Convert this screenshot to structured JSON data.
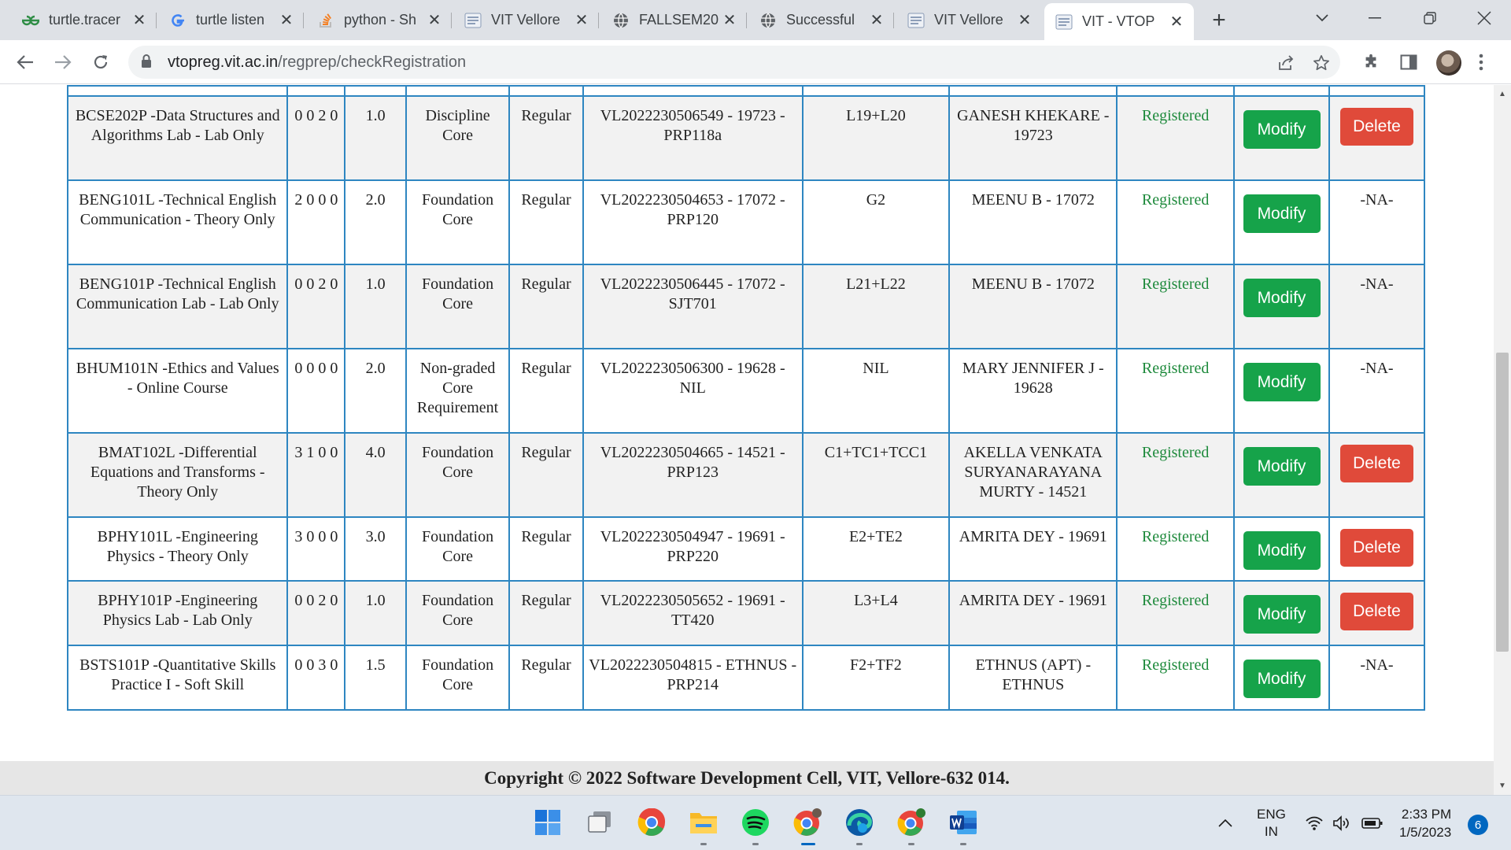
{
  "browser": {
    "tabs": [
      {
        "title": "turtle.tracer",
        "icon": "gfg-icon"
      },
      {
        "title": "turtle listen",
        "icon": "google-icon"
      },
      {
        "title": "python - Sh",
        "icon": "stackoverflow-icon"
      },
      {
        "title": "VIT Vellore",
        "icon": "vit-icon"
      },
      {
        "title": "FALLSEM20",
        "icon": "globe-icon"
      },
      {
        "title": "Successful",
        "icon": "globe-icon"
      },
      {
        "title": "VIT Vellore",
        "icon": "vit-icon"
      },
      {
        "title": "VIT - VTOP",
        "icon": "vit-icon"
      }
    ],
    "active_tab": 7,
    "url_host": "vtopreg.vit.ac.in",
    "url_path": "/regprep/checkRegistration"
  },
  "registrations": [
    {
      "course": "BCSE202P -Data Structures and Algorithms Lab - Lab Only",
      "ltpj": "0 0 2 0",
      "credits": "1.0",
      "category": "Discipline Core",
      "type": "Regular",
      "class_nbr": "VL2022230506549 - 19723 - PRP118a",
      "slot": "L19+L20",
      "faculty": "GANESH KHEKARE - 19723",
      "status": "Registered",
      "modify": "Modify",
      "delete": "Delete"
    },
    {
      "course": "BENG101L -Technical English Communication - Theory Only",
      "ltpj": "2 0 0 0",
      "credits": "2.0",
      "category": "Foundation Core",
      "type": "Regular",
      "class_nbr": "VL2022230504653 - 17072 - PRP120",
      "slot": "G2",
      "faculty": "MEENU B - 17072",
      "status": "Registered",
      "modify": "Modify",
      "delete": "-NA-"
    },
    {
      "course": "BENG101P -Technical English Communication Lab - Lab Only",
      "ltpj": "0 0 2 0",
      "credits": "1.0",
      "category": "Foundation Core",
      "type": "Regular",
      "class_nbr": "VL2022230506445 - 17072 - SJT701",
      "slot": "L21+L22",
      "faculty": "MEENU B - 17072",
      "status": "Registered",
      "modify": "Modify",
      "delete": "-NA-"
    },
    {
      "course": "BHUM101N -Ethics and Values - Online Course",
      "ltpj": "0 0 0 0",
      "credits": "2.0",
      "category": "Non-graded Core Requirement",
      "type": "Regular",
      "class_nbr": "VL2022230506300 - 19628 - NIL",
      "slot": "NIL",
      "faculty": "MARY JENNIFER J - 19628",
      "status": "Registered",
      "modify": "Modify",
      "delete": "-NA-"
    },
    {
      "course": "BMAT102L -Differential Equations and Transforms - Theory Only",
      "ltpj": "3 1 0 0",
      "credits": "4.0",
      "category": "Foundation Core",
      "type": "Regular",
      "class_nbr": "VL2022230504665 - 14521 - PRP123",
      "slot": "C1+TC1+TCC1",
      "faculty": "AKELLA VENKATA SURYANARAYANA MURTY - 14521",
      "status": "Registered",
      "modify": "Modify",
      "delete": "Delete"
    },
    {
      "course": "BPHY101L -Engineering Physics - Theory Only",
      "ltpj": "3 0 0 0",
      "credits": "3.0",
      "category": "Foundation Core",
      "type": "Regular",
      "class_nbr": "VL2022230504947 - 19691 - PRP220",
      "slot": "E2+TE2",
      "faculty": "AMRITA DEY - 19691",
      "status": "Registered",
      "modify": "Modify",
      "delete": "Delete"
    },
    {
      "course": "BPHY101P -Engineering Physics Lab - Lab Only",
      "ltpj": "0 0 2 0",
      "credits": "1.0",
      "category": "Foundation Core",
      "type": "Regular",
      "class_nbr": "VL2022230505652 - 19691 - TT420",
      "slot": "L3+L4",
      "faculty": "AMRITA DEY - 19691",
      "status": "Registered",
      "modify": "Modify",
      "delete": "Delete"
    },
    {
      "course": "BSTS101P -Quantitative Skills Practice I - Soft Skill",
      "ltpj": "0 0 3 0",
      "credits": "1.5",
      "category": "Foundation Core",
      "type": "Regular",
      "class_nbr": "VL2022230504815 - ETHNUS - PRP214",
      "slot": "F2+TF2",
      "faculty": "ETHNUS (APT) - ETHNUS",
      "status": "Registered",
      "modify": "Modify",
      "delete": "-NA-"
    }
  ],
  "footer": {
    "copyright": "Copyright © 2022 Software Development Cell, VIT, Vellore-632 014."
  },
  "taskbar": {
    "lang_top": "ENG",
    "lang_bottom": "IN",
    "time": "2:33 PM",
    "date": "1/5/2023",
    "notification_count": "6"
  },
  "colors": {
    "accent_green": "#16a34a",
    "delete_red": "#e04a3a",
    "table_border": "#2e86c1",
    "status_green": "#1e8a3c"
  }
}
